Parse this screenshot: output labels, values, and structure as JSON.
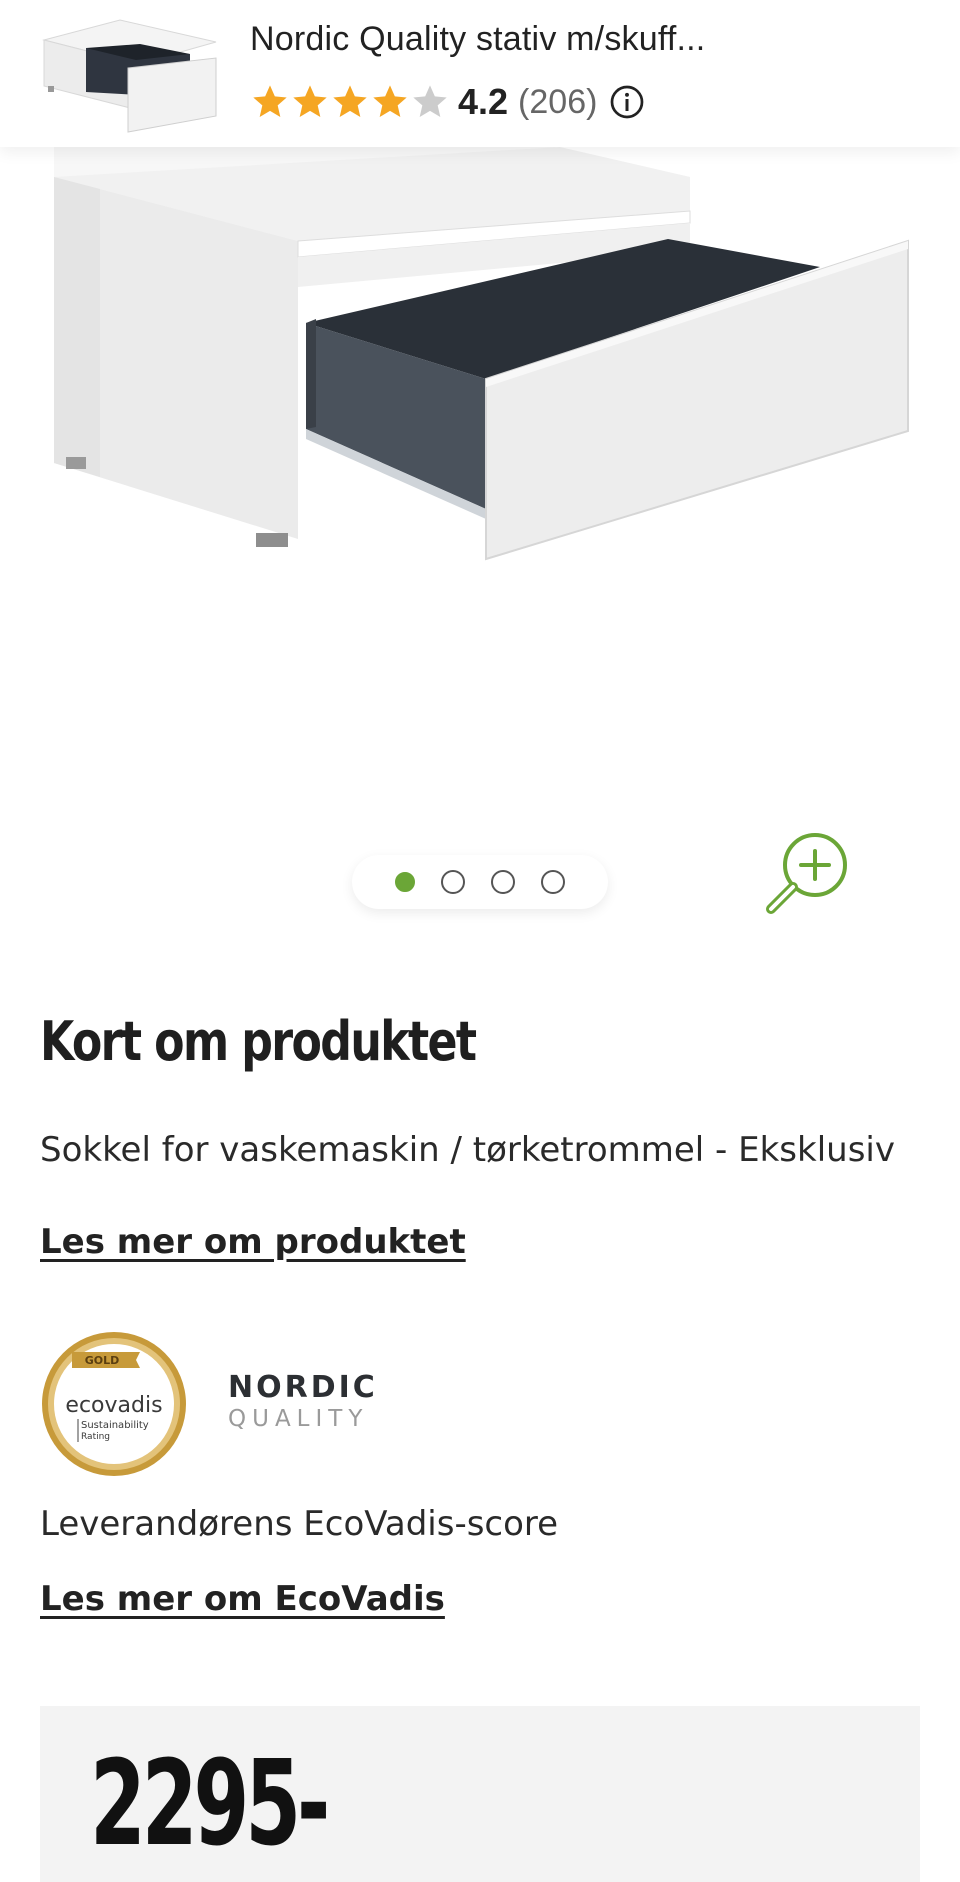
{
  "header": {
    "title": "Nordic Quality stativ m/skuff...",
    "rating_value": "4.2",
    "rating_count": "(206)",
    "rating": 4.2,
    "rating_max": 5,
    "colors": {
      "star_filled": "#f5a623",
      "star_empty": "#cccccc"
    },
    "info_icon": "info-icon"
  },
  "gallery": {
    "slide_count": 4,
    "active_slide": 1,
    "active_dot_color": "#6ba637",
    "zoom_icon": "zoom-in-icon"
  },
  "about": {
    "heading": "Kort om produktet",
    "description": "Sokkel for vaskemaskin / tørketrommel - Eksklusiv",
    "read_more": "Les mer om produktet"
  },
  "sustainability": {
    "badge": {
      "tier": "GOLD",
      "name": "ecovadis",
      "line1": "Sustainability",
      "line2": "Rating"
    },
    "brand": {
      "name": "NORDIC",
      "sub": "QUALITY"
    },
    "score_label": "Leverandørens EcoVadis-score",
    "read_more": "Les mer om EcoVadis"
  },
  "price": {
    "value": "2295-"
  }
}
